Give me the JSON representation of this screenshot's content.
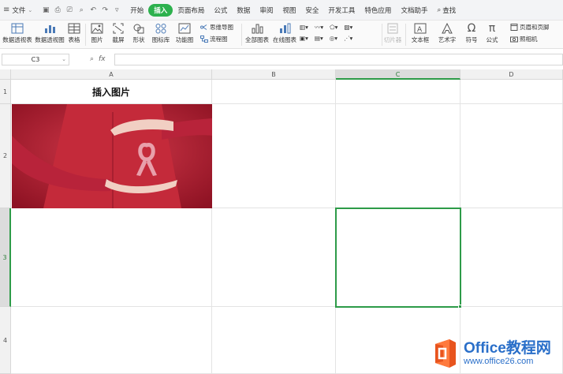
{
  "menubar": {
    "file_label": "文件",
    "tabs": [
      "开始",
      "插入",
      "页面布局",
      "公式",
      "数据",
      "审阅",
      "视图",
      "安全",
      "开发工具",
      "特色应用",
      "文档助手"
    ],
    "active_tab": "插入",
    "search_label": "查找"
  },
  "ribbon": {
    "pivot_table": "数据透视表",
    "pivot_chart": "数据透视图",
    "table": "表格",
    "picture": "图片",
    "screenshot": "截屏",
    "shapes": "形状",
    "icon_library": "图标库",
    "function_chart": "功能图",
    "mind_map": "思维导图",
    "flowchart": "流程图",
    "all_charts": "全部图表",
    "online_chart": "在线图表",
    "slicer": "切片器",
    "text_box": "文本框",
    "art_text": "艺术字",
    "symbol": "符号",
    "formula": "公式",
    "header_footer": "页眉和页脚",
    "camera": "照相机"
  },
  "formula_bar": {
    "cell_ref": "C3",
    "fx": "fx",
    "formula": ""
  },
  "sheet": {
    "columns": [
      "A",
      "B",
      "C",
      "D"
    ],
    "rows": [
      "1",
      "2",
      "3",
      "4"
    ],
    "selected_cell": "C3",
    "a1_text": "插入图片",
    "image_description_colors": {
      "background": "#a3172b",
      "shirt": "#c42a3a",
      "ribbon": "#e8a0ab",
      "hands": "#f1cfc3"
    }
  },
  "watermark": {
    "brand": "Office教程网",
    "url": "www.office26.com"
  },
  "colors": {
    "accent_green": "#2db14e",
    "selection_green": "#2d9b48",
    "watermark_blue": "#2a6fc9",
    "logo_orange": "#e8541e"
  }
}
